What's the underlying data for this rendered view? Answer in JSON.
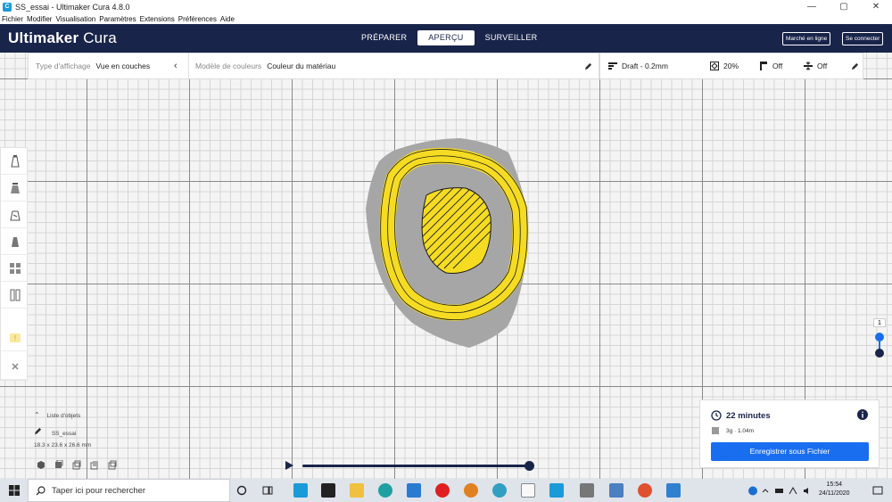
{
  "window": {
    "title": "SS_essai - Ultimaker Cura 4.8.0",
    "minimize": "—",
    "maximize": "▢",
    "close": "✕"
  },
  "menu": [
    "Fichier",
    "Modifier",
    "Visualisation",
    "Paramètres",
    "Extensions",
    "Préférences",
    "Aide"
  ],
  "header": {
    "logo_bold": "Ultimaker",
    "logo_light": " Cura",
    "tabs": [
      {
        "label": "PRÉPARER",
        "active": false
      },
      {
        "label": "APERÇU",
        "active": true
      },
      {
        "label": "SURVEILLER",
        "active": false
      }
    ],
    "marketplace": "Marché en ligne",
    "signin": "Se connecter"
  },
  "view_bar": {
    "view_type_label": "Type d'affichage",
    "view_type_value": "Vue en couches",
    "color_scheme_label": "Modèle de couleurs",
    "color_scheme_value": "Couleur du matériau"
  },
  "print_settings": {
    "profile": "Draft - 0.2mm",
    "infill": "20%",
    "support": "Off",
    "adhesion": "Off"
  },
  "object_list": {
    "header": "Liste d'objets",
    "name": "SS_essai",
    "dimensions": "18.3 x 23.6 x 26.6 mm"
  },
  "layer_slider": {
    "value": "1"
  },
  "print_panel": {
    "time": "22 minutes",
    "material": "3g · 1.04m",
    "save_button": "Enregistrer sous Fichier"
  },
  "taskbar": {
    "search_placeholder": "Taper ici pour rechercher",
    "time": "15:54",
    "date": "24/11/2020"
  },
  "colors": {
    "header": "#19244a",
    "accent_blue": "#196ef0",
    "layer_yellow": "#f5dc22",
    "model_gray": "#a6a6a6"
  }
}
